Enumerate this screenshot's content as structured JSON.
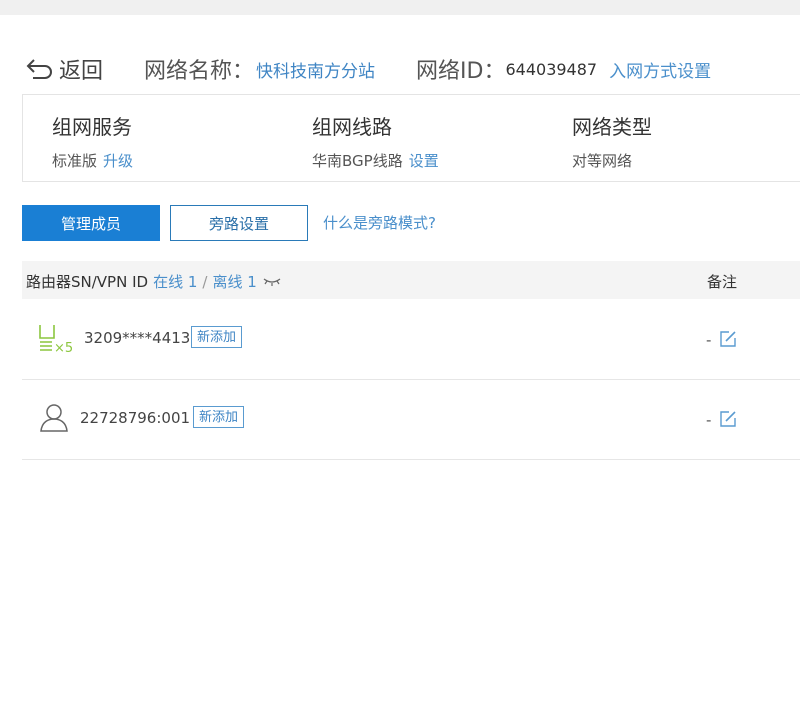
{
  "header": {
    "back_label": "返回",
    "network_name_label": "网络名称：",
    "network_name": "快科技南方分站",
    "network_id_label": "网络ID：",
    "network_id": "644039487",
    "access_settings_link": "入网方式设置"
  },
  "info": {
    "service": {
      "title": "组网服务",
      "value": "标准版",
      "link": "升级"
    },
    "line": {
      "title": "组网线路",
      "value": "华南BGP线路",
      "link": "设置"
    },
    "type": {
      "title": "网络类型",
      "value": "对等网络"
    }
  },
  "actions": {
    "manage_members": "管理成员",
    "bypass_settings": "旁路设置",
    "bypass_help": "什么是旁路模式?"
  },
  "table": {
    "col_device": "路由器SN/VPN ID",
    "online": "在线 1",
    "sep": "/",
    "offline": "离线 1",
    "col_note": "备注",
    "rows": [
      {
        "icon": "router-x5-icon",
        "id": "3209****4413",
        "badge": "新添加",
        "note": "-"
      },
      {
        "icon": "user-icon",
        "id": "22728796:001",
        "badge": "新添加",
        "note": "-"
      }
    ]
  },
  "colors": {
    "primary": "#1a7fd4",
    "link": "#4a8fcb",
    "router_green": "#8cc63f"
  }
}
